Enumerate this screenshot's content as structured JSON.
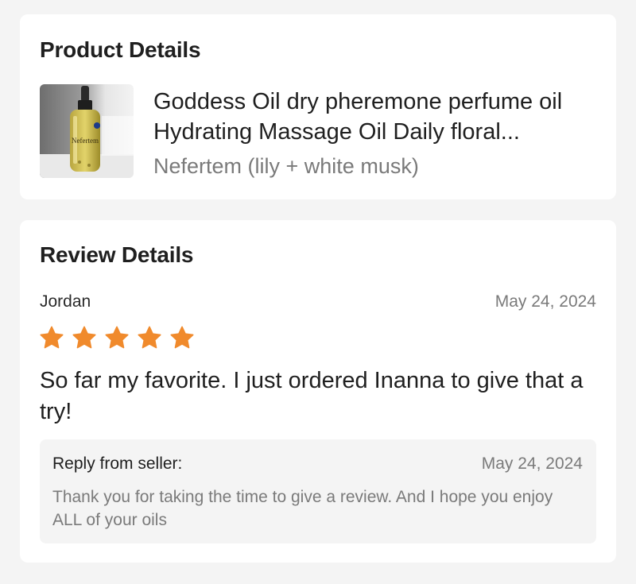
{
  "product_details": {
    "title": "Product Details",
    "image_icon": "perfume-bottle-image",
    "image_label": "Nefertem",
    "name": "Goddess Oil dry pheremone perfume oil Hydrating Massage Oil Daily floral...",
    "variant": "Nefertem (lily + white musk)"
  },
  "review_details": {
    "title": "Review Details",
    "reviewer": "Jordan",
    "date": "May 24, 2024",
    "rating": 5,
    "rating_max": 5,
    "star_color": "#f08a2c",
    "text": "So far my favorite. I just ordered Inanna to give that a try!",
    "reply": {
      "label": "Reply from seller:",
      "date": "May 24, 2024",
      "text": "Thank you for taking the time to give a review. And I hope you enjoy ALL of your oils"
    }
  }
}
